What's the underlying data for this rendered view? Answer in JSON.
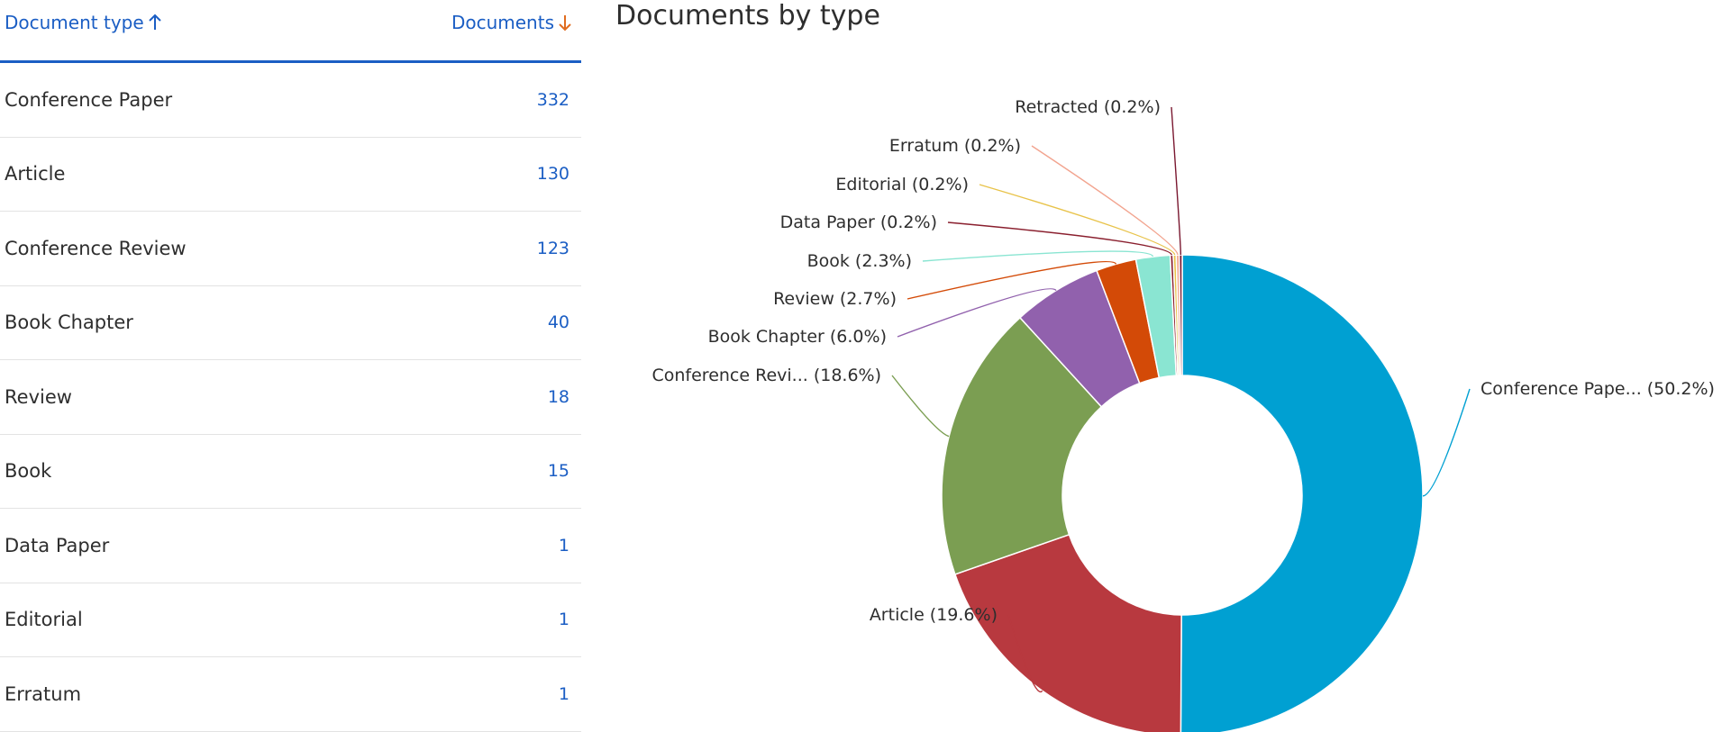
{
  "table": {
    "col_type": "Document type",
    "col_docs": "Documents",
    "rows": [
      {
        "type": "Conference Paper",
        "count": "332"
      },
      {
        "type": "Article",
        "count": "130"
      },
      {
        "type": "Conference Review",
        "count": "123"
      },
      {
        "type": "Book Chapter",
        "count": "40"
      },
      {
        "type": "Review",
        "count": "18"
      },
      {
        "type": "Book",
        "count": "15"
      },
      {
        "type": "Data Paper",
        "count": "1"
      },
      {
        "type": "Editorial",
        "count": "1"
      },
      {
        "type": "Erratum",
        "count": "1"
      }
    ]
  },
  "chart_data": {
    "type": "pie",
    "title": "Documents by type",
    "slices": [
      {
        "label": "Conference Pape... (50.2%)",
        "value": 50.2,
        "color": "#00a0d2"
      },
      {
        "label": "Article (19.6%)",
        "value": 19.6,
        "color": "#b8393f"
      },
      {
        "label": "Conference Revi... (18.6%)",
        "value": 18.6,
        "color": "#7b9e52"
      },
      {
        "label": "Book Chapter (6.0%)",
        "value": 6.0,
        "color": "#9161ad"
      },
      {
        "label": "Review (2.7%)",
        "value": 2.7,
        "color": "#d34a07"
      },
      {
        "label": "Book (2.3%)",
        "value": 2.3,
        "color": "#8ae5d2"
      },
      {
        "label": "Data Paper (0.2%)",
        "value": 0.2,
        "color": "#8a1f2e"
      },
      {
        "label": "Editorial (0.2%)",
        "value": 0.2,
        "color": "#e8c34a"
      },
      {
        "label": "Erratum (0.2%)",
        "value": 0.2,
        "color": "#f2a48f"
      },
      {
        "label": "Retracted (0.2%)",
        "value": 0.2,
        "color": "#7a1830"
      }
    ]
  }
}
